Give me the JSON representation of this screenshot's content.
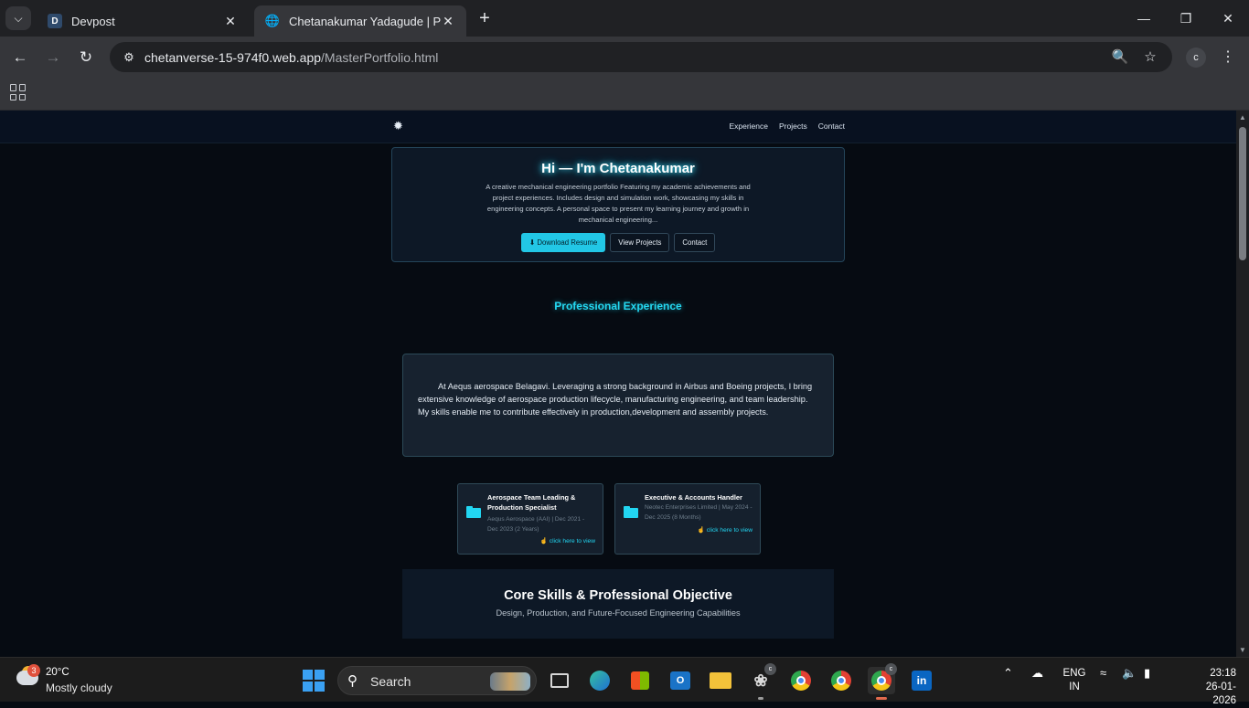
{
  "browser": {
    "tabs": [
      {
        "title": "Devpost",
        "favicon": "D",
        "active": false
      },
      {
        "title": "Chetanakumar Yadagude | Portf",
        "active": true
      }
    ],
    "url_host": "chetanverse-15-974f0.web.app",
    "url_path": "/MasterPortfolio.html",
    "profile_initial": "c"
  },
  "site": {
    "logo_icon": "gear-icon",
    "nav": [
      "Experience",
      "Projects",
      "Contact"
    ],
    "hero": {
      "heading": "Hi — I'm Chetanakumar",
      "description": "A creative mechanical engineering portfolio Featuring my academic achievements and project experiences. Includes design and simulation work, showcasing my skills in engineering concepts. A personal space to present my learning journey and growth in mechanical engineering...",
      "buttons": {
        "download": "Download Resume",
        "projects": "View Projects",
        "contact": "Contact"
      }
    },
    "experience": {
      "title": "Professional Experience",
      "summary": "At Aequs aerospace Belagavi. Leveraging a strong background in Airbus and Boeing projects, I bring extensive knowledge of aerospace production lifecycle, manufacturing engineering, and team leadership. My skills enable me to contribute effectively in production,development and assembly projects.",
      "cards": [
        {
          "title": "Aerospace Team Leading & Production Specialist",
          "meta": "Aequs Aerospace (AAI) | Dec 2021 - Dec 2023 (2 Years)",
          "link": "click here to view"
        },
        {
          "title": "Executive & Accounts Handler",
          "meta": "Neotec Enterprises Limited | May 2024 - Dec 2025 (8 Months)",
          "link": "click here to view"
        }
      ]
    },
    "skills": {
      "title": "Core Skills & Professional Objective",
      "subtitle": "Design, Production, and Future-Focused Engineering Capabilities"
    }
  },
  "taskbar": {
    "weather": {
      "temp": "20°C",
      "condition": "Mostly cloudy",
      "badge": "3"
    },
    "search_label": "Search",
    "language": {
      "line1": "ENG",
      "line2": "IN"
    },
    "clock": {
      "time": "23:18",
      "date": "26-01-2026"
    },
    "app_badge": "c"
  },
  "colors": {
    "accent": "#22d6f2",
    "page_bg": "#060b12",
    "card_bg": "#15202d"
  }
}
